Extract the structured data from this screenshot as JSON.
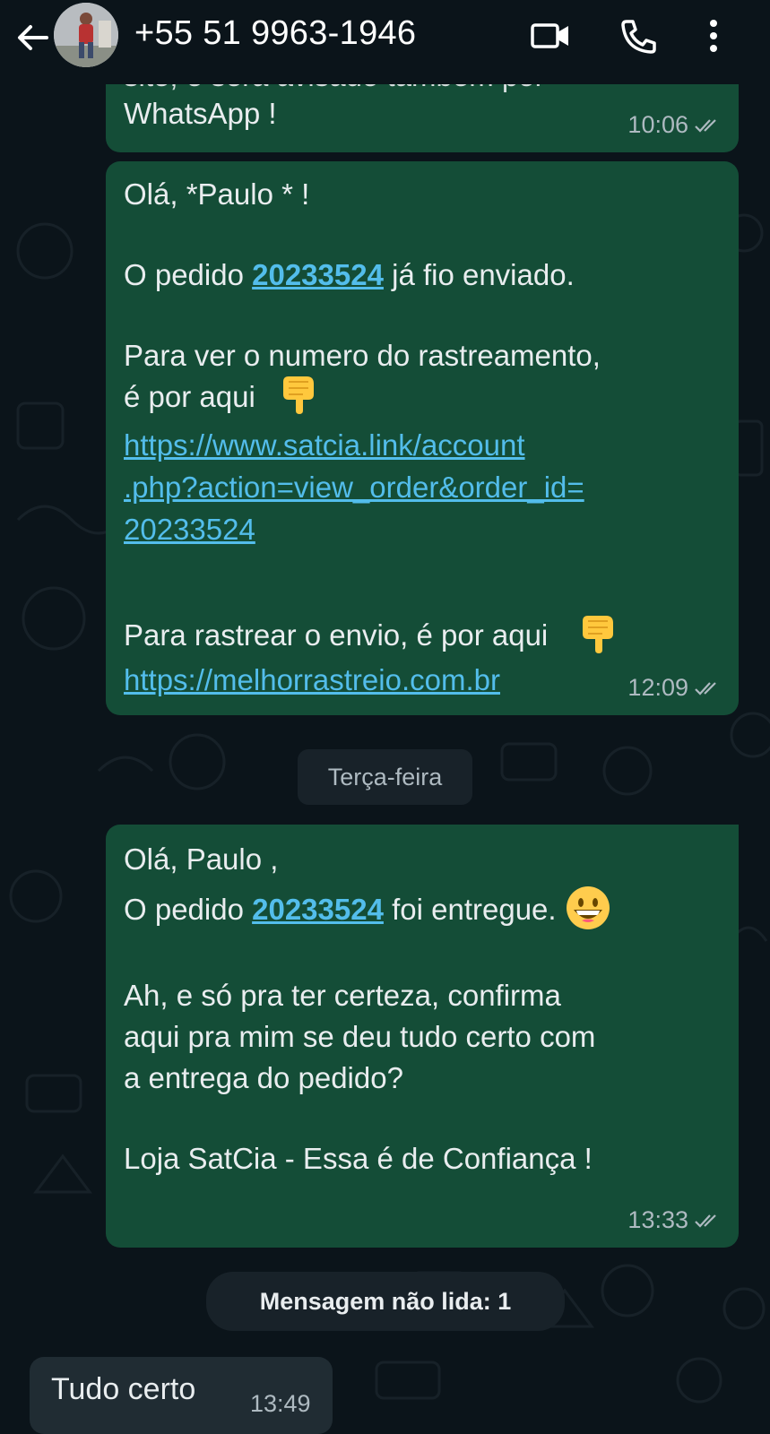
{
  "header": {
    "contact_name": "+55 51 9963-1946"
  },
  "messages": [
    {
      "text_partial_top": "site, e será avisado também por",
      "text_last": "WhatsApp !",
      "time": "10:06"
    },
    {
      "greeting": "Olá, *Paulo * !",
      "line1_prefix": "O pedido ",
      "order_number": "20233524",
      "line1_suffix": " já fio enviado.",
      "line2": "Para ver o numero do rastreamento,",
      "line3": "é por aqui",
      "link1_line1": "https://www.satcia.link/account",
      "link1_line2": ".php?action=view_order&order_id=",
      "link1_line3": "20233524",
      "line4": "Para rastrear o envio, é por aqui",
      "link2": "https://melhorrastreio.com.br",
      "time": "12:09"
    },
    {
      "greeting": "Olá, Paulo ,",
      "line1_prefix": "O pedido ",
      "order_number": "20233524",
      "line1_suffix": " foi entregue.",
      "line2": "Ah, e só pra ter certeza, confirma",
      "line3": "aqui pra mim se deu tudo certo com",
      "line4": "a entrega do pedido?",
      "line5": "Loja SatCia - Essa é de Confiança !",
      "time": "13:33"
    }
  ],
  "day_separator": "Terça-feira",
  "unread_banner": "Mensagem não lida: 1",
  "incoming": {
    "text": "Tudo certo",
    "time": "13:49"
  },
  "icons": [
    "back-arrow-icon",
    "video-call-icon",
    "phone-icon",
    "more-options-icon",
    "read-ticks-icon",
    "pointing-down-emoji",
    "grinning-emoji"
  ],
  "colors": {
    "background": "#0b141a",
    "outgoing_bubble": "#144d37",
    "incoming_bubble": "#202c33",
    "link": "#53bdeb",
    "meta_text": "#aebac1"
  }
}
